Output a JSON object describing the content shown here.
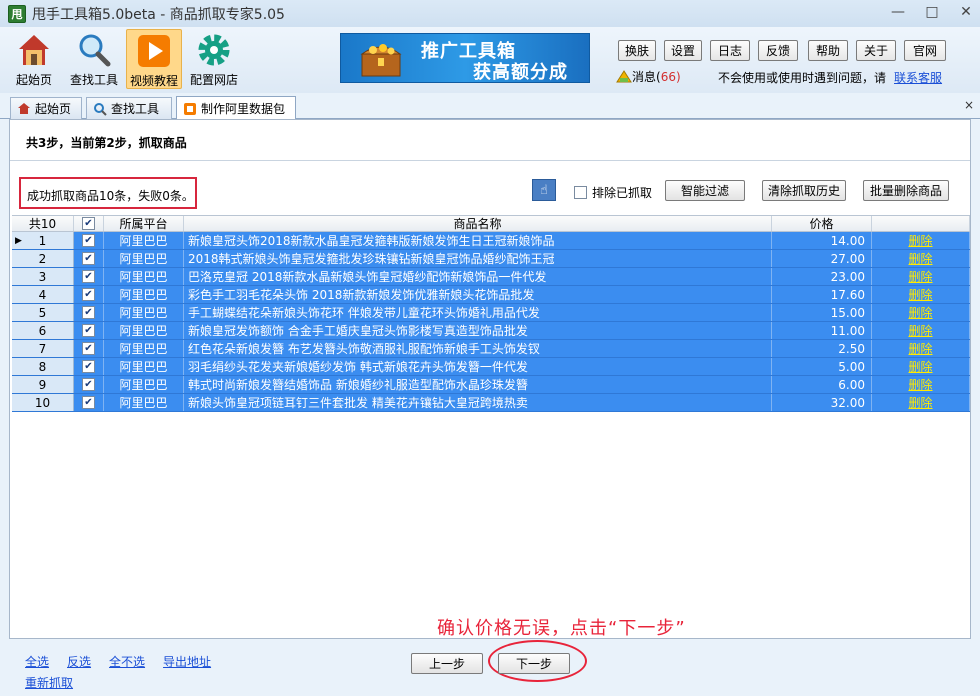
{
  "window": {
    "app_badge": "甩",
    "title": "甩手工具箱5.0beta - 商品抓取专家5.05",
    "controls": [
      "—",
      "□",
      "✕"
    ]
  },
  "toolbar": {
    "tools": [
      {
        "label": "起始页",
        "icon": "home-icon"
      },
      {
        "label": "查找工具",
        "icon": "magnifier-icon"
      },
      {
        "label": "视频教程",
        "icon": "video-play-icon"
      },
      {
        "label": "配置网店",
        "icon": "gear-icon"
      }
    ],
    "banner": {
      "line1": "推广工具箱",
      "line2": "获高额分成"
    },
    "top_buttons": [
      "换肤",
      "设置",
      "日志",
      "反馈",
      "帮助",
      "关于",
      "官网"
    ],
    "message_label": "消息(",
    "message_count": "66",
    "message_close": ")",
    "notice": "不会使用或使用时遇到问题，请",
    "notice_link": "联系客服"
  },
  "tabs": [
    {
      "label": "起始页",
      "icon": "home-icon"
    },
    {
      "label": "查找工具",
      "icon": "magnifier-icon"
    },
    {
      "label": "制作阿里数据包",
      "icon": "package-icon"
    }
  ],
  "tab_close": "×",
  "step_text": "共3步，当前第2步，抓取商品",
  "result_text": "成功抓取商品10条，失败0条。",
  "actions": {
    "exclude_label": "排除已抓取",
    "smart_filter": "智能过滤",
    "clear_history": "清除抓取历史",
    "batch_delete": "批量删除商品"
  },
  "grid": {
    "headers": {
      "total": "共10",
      "platform": "所属平台",
      "name": "商品名称",
      "price": "价格",
      "action": ""
    },
    "check": "✔",
    "rows": [
      {
        "idx": "1",
        "platform": "阿里巴巴",
        "name": "新娘皇冠头饰2018新款水晶皇冠发箍韩版新娘发饰生日王冠新娘饰品",
        "price": "14.00",
        "action": "删除"
      },
      {
        "idx": "2",
        "platform": "阿里巴巴",
        "name": "2018韩式新娘头饰皇冠发箍批发珍珠镶钻新娘皇冠饰品婚纱配饰王冠",
        "price": "27.00",
        "action": "删除"
      },
      {
        "idx": "3",
        "platform": "阿里巴巴",
        "name": "巴洛克皇冠 2018新款水晶新娘头饰皇冠婚纱配饰新娘饰品一件代发",
        "price": "23.00",
        "action": "删除"
      },
      {
        "idx": "4",
        "platform": "阿里巴巴",
        "name": "彩色手工羽毛花朵头饰 2018新款新娘发饰优雅新娘头花饰品批发",
        "price": "17.60",
        "action": "删除"
      },
      {
        "idx": "5",
        "platform": "阿里巴巴",
        "name": "手工蝴蝶结花朵新娘头饰花环 伴娘发带儿童花环头饰婚礼用品代发",
        "price": "15.00",
        "action": "删除"
      },
      {
        "idx": "6",
        "platform": "阿里巴巴",
        "name": "新娘皇冠发饰额饰 合金手工婚庆皇冠头饰影楼写真造型饰品批发",
        "price": "11.00",
        "action": "删除"
      },
      {
        "idx": "7",
        "platform": "阿里巴巴",
        "name": "红色花朵新娘发簪 布艺发簪头饰敬酒服礼服配饰新娘手工头饰发钗",
        "price": "2.50",
        "action": "删除"
      },
      {
        "idx": "8",
        "platform": "阿里巴巴",
        "name": "羽毛绢纱头花发夹新娘婚纱发饰 韩式新娘花卉头饰发簪一件代发",
        "price": "5.00",
        "action": "删除"
      },
      {
        "idx": "9",
        "platform": "阿里巴巴",
        "name": "韩式时尚新娘发簪结婚饰品 新娘婚纱礼服造型配饰水晶珍珠发簪",
        "price": "6.00",
        "action": "删除"
      },
      {
        "idx": "10",
        "platform": "阿里巴巴",
        "name": "新娘头饰皇冠项链耳钉三件套批发 精美花卉镶钻大皇冠跨境热卖",
        "price": "32.00",
        "action": "删除"
      }
    ]
  },
  "bottom": {
    "links": [
      "全选",
      "反选",
      "全不选",
      "导出地址"
    ],
    "refetch": "重新抓取",
    "prev": "上一步",
    "next": "下一步"
  },
  "annotation": {
    "hint": "确认价格无误，点击“下一步”",
    "color": "#e8243a"
  },
  "colors": {
    "selected_row": "#3b8df0",
    "delete_link": "#ffea00",
    "link": "#1a4fd6"
  }
}
